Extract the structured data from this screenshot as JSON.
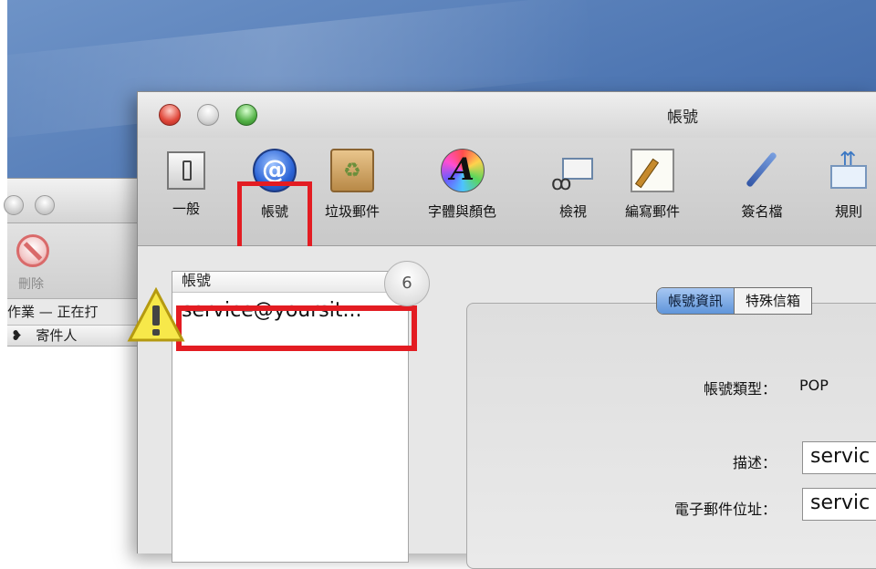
{
  "window": {
    "title": "帳號"
  },
  "toolbar": {
    "items": [
      {
        "label": "一般",
        "icon": "general-switch-icon"
      },
      {
        "label": "帳號",
        "icon": "at-sign-icon"
      },
      {
        "label": "垃圾郵件",
        "icon": "junk-mail-icon"
      },
      {
        "label": "字體與顏色",
        "icon": "fonts-colors-icon"
      },
      {
        "label": "檢視",
        "icon": "view-glasses-icon"
      },
      {
        "label": "編寫郵件",
        "icon": "compose-pencil-icon"
      },
      {
        "label": "簽名檔",
        "icon": "signature-pen-icon"
      },
      {
        "label": "規則",
        "icon": "rules-icon"
      }
    ],
    "selected": "帳號"
  },
  "accounts": {
    "header": "帳號",
    "items": [
      "service@yoursit..."
    ],
    "step_badge": "6"
  },
  "tabs": {
    "active": "帳號資訊",
    "next": "特殊信箱"
  },
  "form": {
    "account_type_label": "帳號類型：",
    "account_type_value": "POP",
    "description_label": "描述：",
    "description_value": "servic",
    "email_label": "電子郵件位址：",
    "email_value": "servic"
  },
  "background_window": {
    "delete_label": "刪除",
    "status_text": "作業 — 正在打",
    "column_header": "寄件人"
  },
  "colors": {
    "highlight": "#e31c22",
    "tab_active": "#5f95da"
  }
}
